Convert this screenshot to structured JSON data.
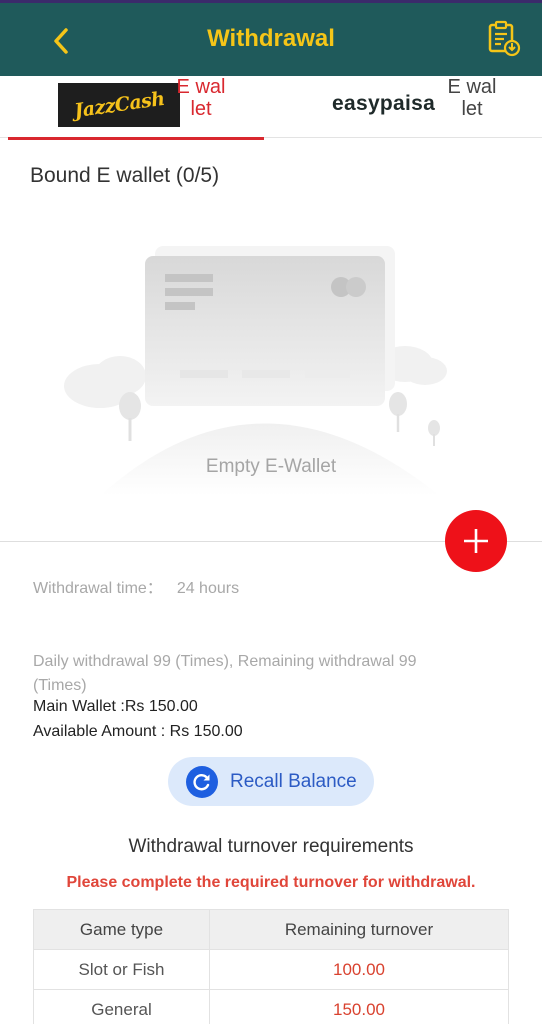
{
  "header": {
    "title": "Withdrawal",
    "back_icon": "chevron-left-icon",
    "records_icon": "clipboard-download-icon",
    "colors": {
      "bar": "#1f5a5b",
      "title": "#f5c518"
    }
  },
  "tabs": [
    {
      "logo_text": "JazzCash",
      "label": "E wallet",
      "active": true
    },
    {
      "logo_text": "easypaisa",
      "label": "E wallet",
      "active": false
    }
  ],
  "wallet": {
    "bound_title": "Bound E wallet (0/5)",
    "empty_text": "Empty E-Wallet",
    "add_icon": "plus-icon"
  },
  "info": {
    "withdrawal_time_label": "Withdrawal time：",
    "withdrawal_time_value": "24 hours",
    "daily_text": "Daily withdrawal 99 (Times), Remaining withdrawal 99 (Times)",
    "main_wallet": "Main Wallet :Rs 150.00",
    "available_amount": "Available Amount : Rs 150.00"
  },
  "recall": {
    "label": "Recall Balance",
    "icon": "refresh-icon"
  },
  "turnover": {
    "title": "Withdrawal turnover requirements",
    "warning": "Please complete the required turnover for withdrawal.",
    "columns": [
      "Game type",
      "Remaining turnover"
    ],
    "rows": [
      {
        "game_type": "Slot or Fish",
        "remaining": "100.00"
      },
      {
        "game_type": "General",
        "remaining": "150.00"
      }
    ]
  },
  "accent_colors": {
    "red": "#d9282f",
    "blue": "#1e5fe0"
  }
}
